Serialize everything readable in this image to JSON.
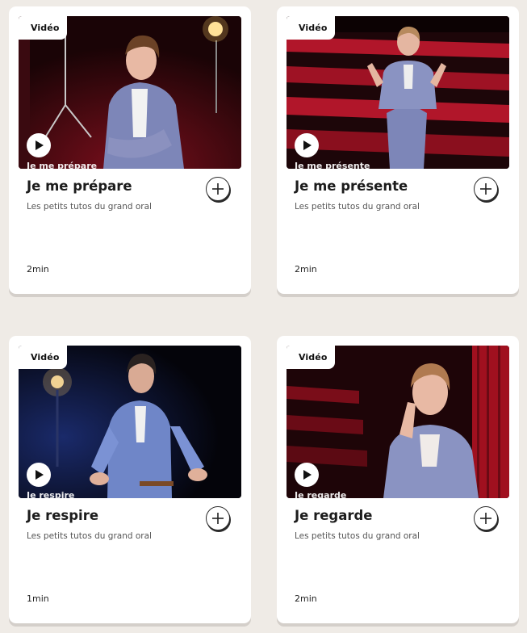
{
  "cards": [
    {
      "badge": "Vidéo",
      "overlay": "Je me prépare",
      "title": "Je me prépare",
      "subtitle": "Les petits tutos du grand oral",
      "duration": "2min",
      "add_icon": "plus-circle-icon",
      "play_icon": "play-icon"
    },
    {
      "badge": "Vidéo",
      "overlay": "Je me présente",
      "title": "Je me présente",
      "subtitle": "Les petits tutos du grand oral",
      "duration": "2min",
      "add_icon": "plus-circle-icon",
      "play_icon": "play-icon"
    },
    {
      "badge": "Vidéo",
      "overlay": "Je respire",
      "title": "Je respire",
      "subtitle": "Les petits tutos du grand oral",
      "duration": "1min",
      "add_icon": "plus-circle-icon",
      "play_icon": "play-icon"
    },
    {
      "badge": "Vidéo",
      "overlay": "Je regarde",
      "title": "Je regarde",
      "subtitle": "Les petits tutos du grand oral",
      "duration": "2min",
      "add_icon": "plus-circle-icon",
      "play_icon": "play-icon"
    }
  ],
  "colors": {
    "page_background": "#efebe6",
    "card_background": "#ffffff",
    "accent_red": "#c0182a"
  }
}
